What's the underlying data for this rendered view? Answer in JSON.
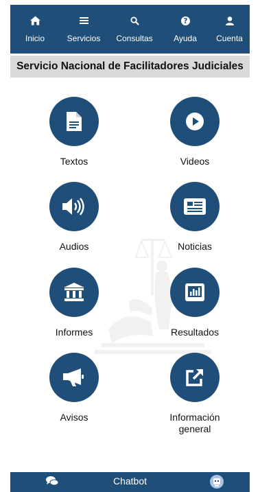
{
  "nav": {
    "items": [
      {
        "label": "Inicio",
        "icon": "home-icon"
      },
      {
        "label": "Servicios",
        "icon": "menu-icon"
      },
      {
        "label": "Consultas",
        "icon": "search-icon"
      },
      {
        "label": "Ayuda",
        "icon": "help-icon"
      },
      {
        "label": "Cuenta",
        "icon": "user-icon"
      }
    ]
  },
  "page": {
    "title": "Servicio Nacional de Facilitadores Judiciales"
  },
  "tiles": [
    {
      "label": "Textos",
      "icon": "document-icon"
    },
    {
      "label": "Videos",
      "icon": "play-icon"
    },
    {
      "label": "Audios",
      "icon": "speaker-icon"
    },
    {
      "label": "Noticias",
      "icon": "newspaper-icon"
    },
    {
      "label": "Informes",
      "icon": "institution-icon"
    },
    {
      "label": "Resultados",
      "icon": "bar-chart-icon"
    },
    {
      "label": "Avisos",
      "icon": "megaphone-icon"
    },
    {
      "label": "Información",
      "label2": "general",
      "icon": "external-link-icon"
    }
  ],
  "footer": {
    "chat_label": "Chatbot",
    "chat_icon": "chat-bubbles-icon",
    "avatar_icon": "bot-avatar-icon"
  },
  "colors": {
    "primary": "#1f4e79",
    "title_bar": "#d9d9d9",
    "text": "#111111"
  }
}
